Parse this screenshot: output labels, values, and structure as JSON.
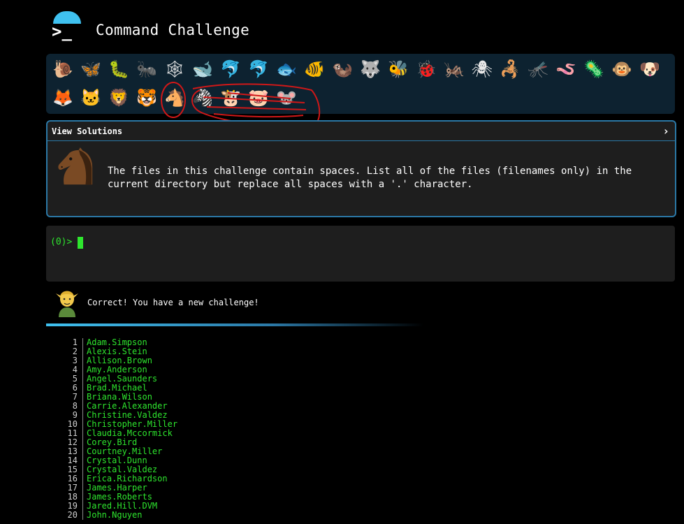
{
  "header": {
    "title": "Command Challenge",
    "logo_glyph": ">_"
  },
  "tray": {
    "row1": [
      "🐌",
      "🦋",
      "🐛",
      "🐜",
      "🕸",
      "🐋",
      "🐬",
      "🐬",
      "🐟",
      "🐠",
      "🦦",
      "🐺",
      "🐝",
      "🐞",
      "🦗",
      "🕷",
      "🦂",
      "🦟",
      "🪱",
      "🦠",
      "🐵",
      "🐶"
    ],
    "row2": [
      "🦊",
      "🐱",
      "🦁",
      "🐯",
      "🐴",
      "🦓",
      "🐮",
      "🐷",
      "🐭"
    ]
  },
  "solutions": {
    "header": "View Solutions",
    "chevron": "›",
    "description": "The files in this challenge contain spaces. List all of the files (filenames only) in the current directory but replace all spaces with a '.' character."
  },
  "terminal": {
    "prompt": "(0)>"
  },
  "message": {
    "text": "Correct! You have a new challenge!"
  },
  "output": {
    "lines": [
      {
        "n": "1",
        "v": "Adam.Simpson"
      },
      {
        "n": "2",
        "v": "Alexis.Stein"
      },
      {
        "n": "3",
        "v": "Allison.Brown"
      },
      {
        "n": "4",
        "v": "Amy.Anderson"
      },
      {
        "n": "5",
        "v": "Angel.Saunders"
      },
      {
        "n": "6",
        "v": "Brad.Michael"
      },
      {
        "n": "7",
        "v": "Briana.Wilson"
      },
      {
        "n": "8",
        "v": "Carrie.Alexander"
      },
      {
        "n": "9",
        "v": "Christine.Valdez"
      },
      {
        "n": "10",
        "v": "Christopher.Miller"
      },
      {
        "n": "11",
        "v": "Claudia.Mccormick"
      },
      {
        "n": "12",
        "v": "Corey.Bird"
      },
      {
        "n": "13",
        "v": "Courtney.Miller"
      },
      {
        "n": "14",
        "v": "Crystal.Dunn"
      },
      {
        "n": "15",
        "v": "Crystal.Valdez"
      },
      {
        "n": "16",
        "v": "Erica.Richardson"
      },
      {
        "n": "17",
        "v": "James.Harper"
      },
      {
        "n": "18",
        "v": "James.Roberts"
      },
      {
        "n": "19",
        "v": "Jared.Hill.DVM"
      },
      {
        "n": "20",
        "v": "John.Nguyen"
      }
    ]
  }
}
